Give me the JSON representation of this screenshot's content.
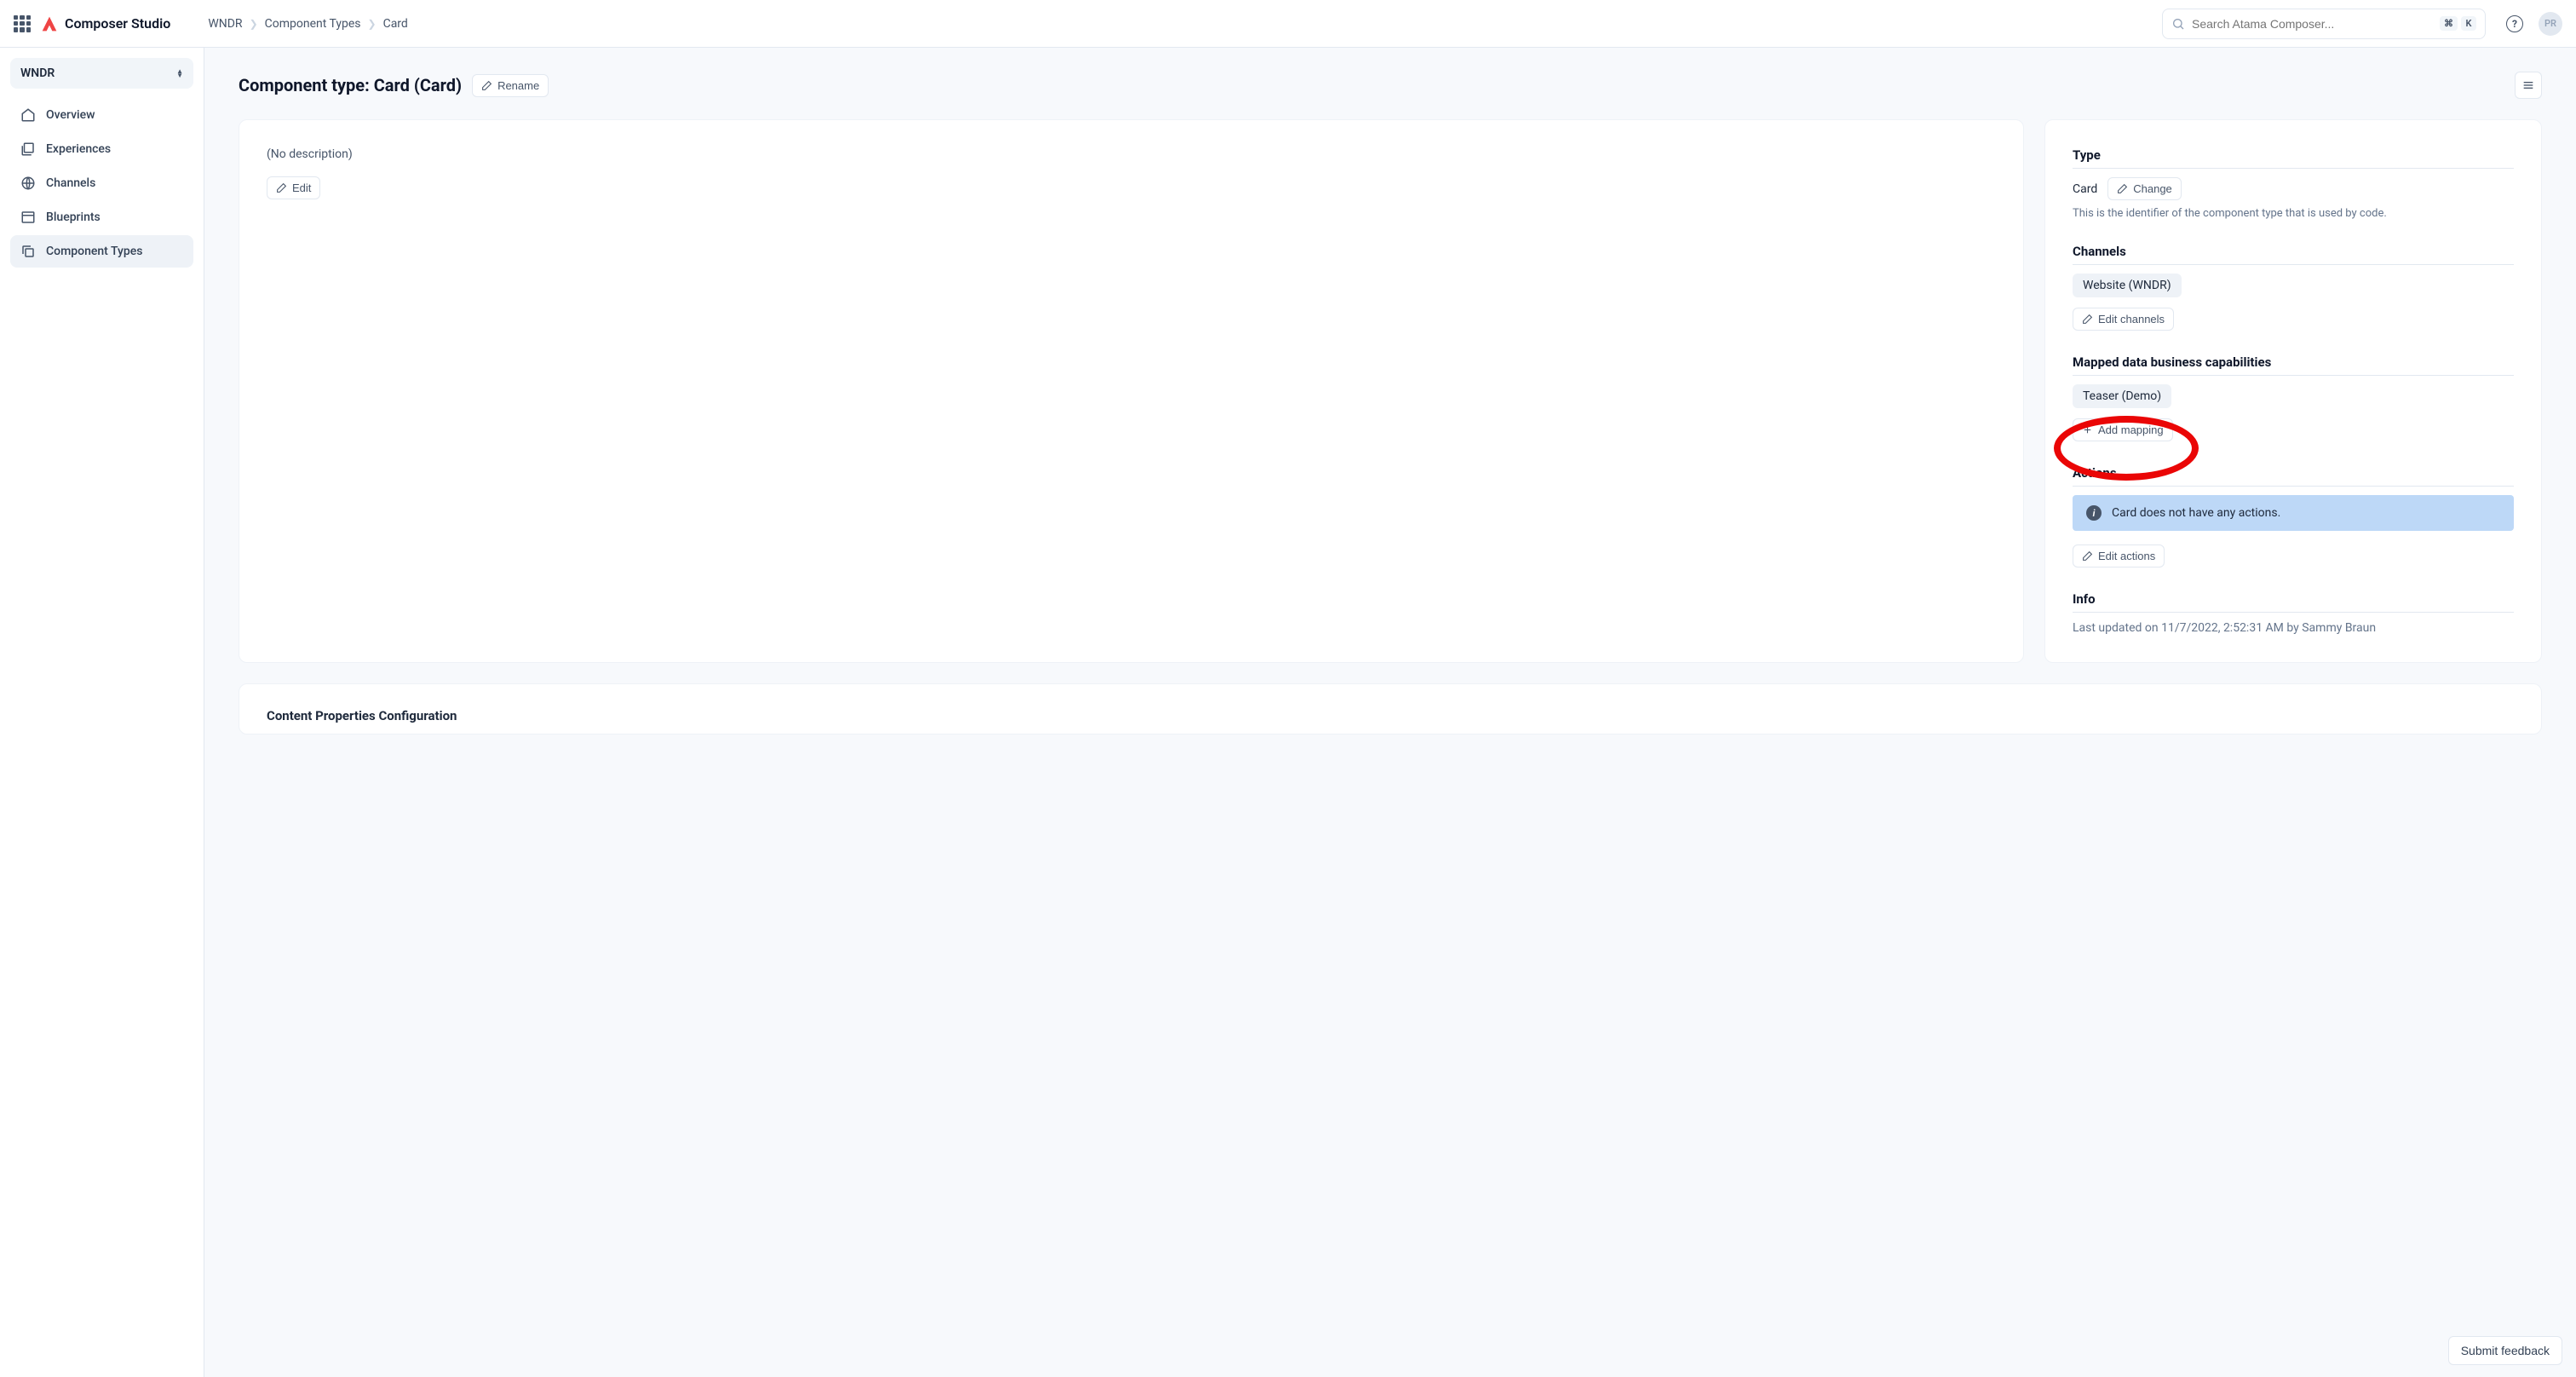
{
  "app": {
    "name": "Composer Studio",
    "avatar_initials": "PR"
  },
  "breadcrumbs": {
    "items": [
      "WNDR",
      "Component Types",
      "Card"
    ]
  },
  "search": {
    "placeholder": "Search Atama Composer...",
    "kbd1": "⌘",
    "kbd2": "K"
  },
  "workspace": {
    "name": "WNDR"
  },
  "sidebar": {
    "items": [
      {
        "label": "Overview",
        "icon": "home",
        "active": false
      },
      {
        "label": "Experiences",
        "icon": "layers",
        "active": false
      },
      {
        "label": "Channels",
        "icon": "globe",
        "active": false
      },
      {
        "label": "Blueprints",
        "icon": "layout",
        "active": false
      },
      {
        "label": "Component Types",
        "icon": "copy",
        "active": true
      }
    ]
  },
  "page": {
    "title": "Component type: Card (Card)",
    "rename_label": "Rename"
  },
  "left_panel": {
    "no_description": "(No description)",
    "edit_label": "Edit"
  },
  "right_panel": {
    "type_section": {
      "label": "Type",
      "value": "Card",
      "change_label": "Change",
      "help": "This is the identifier of the component type that is used by code."
    },
    "channels_section": {
      "label": "Channels",
      "chip": "Website (WNDR)",
      "edit_label": "Edit channels"
    },
    "mapped_section": {
      "label": "Mapped data business capabilities",
      "chip": "Teaser (Demo)",
      "add_label": "Add mapping"
    },
    "actions_section": {
      "label": "Actions",
      "banner": "Card does not have any actions.",
      "edit_label": "Edit actions"
    },
    "info_section": {
      "label": "Info",
      "text": "Last updated on 11/7/2022, 2:52:31 AM by Sammy Braun"
    }
  },
  "bottom": {
    "title": "Content Properties Configuration"
  },
  "feedback": {
    "label": "Submit feedback"
  }
}
